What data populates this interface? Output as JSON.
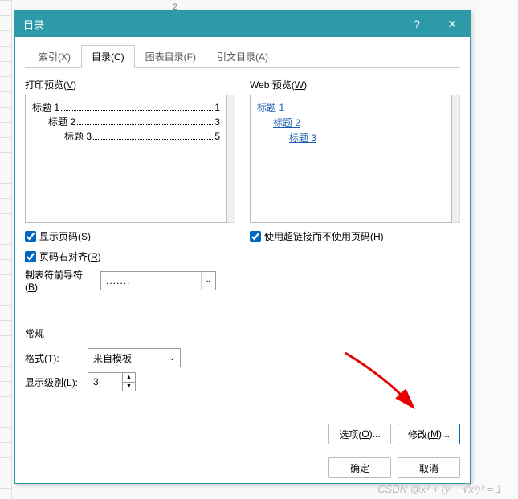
{
  "titlebar": {
    "title": "目录",
    "help": "?",
    "close": "✕"
  },
  "tabs": [
    {
      "label": "索引(X)"
    },
    {
      "label": "目录(C)"
    },
    {
      "label": "图表目录(F)"
    },
    {
      "label": "引文目录(A)"
    }
  ],
  "printPreview": {
    "label_pre": "打印预览(",
    "label_key": "V",
    "label_post": ")",
    "items": [
      {
        "indent": 0,
        "label": "标题 1",
        "page": "1"
      },
      {
        "indent": 1,
        "label": "标题 2",
        "page": "3"
      },
      {
        "indent": 2,
        "label": "标题 3",
        "page": "5"
      }
    ]
  },
  "webPreview": {
    "label_pre": "Web 预览(",
    "label_key": "W",
    "label_post": ")",
    "items": [
      {
        "indent": 0,
        "label": "标题 1"
      },
      {
        "indent": 1,
        "label": "标题 2"
      },
      {
        "indent": 2,
        "label": "标题 3"
      }
    ]
  },
  "options": {
    "showPageNum": {
      "pre": "显示页码(",
      "key": "S",
      "post": ")"
    },
    "rightAlign": {
      "pre": "页码右对齐(",
      "key": "R",
      "post": ")"
    },
    "useHyperlinks": {
      "pre": "使用超链接而不使用页码(",
      "key": "H",
      "post": ")"
    }
  },
  "leader": {
    "label_pre": "制表符前导符(",
    "label_key": "B",
    "label_post": "):",
    "value": "......."
  },
  "general": {
    "title": "常规",
    "format": {
      "label_pre": "格式(",
      "label_key": "T",
      "label_post": "):",
      "value": "来自模板"
    },
    "levels": {
      "label_pre": "显示级别(",
      "label_key": "L",
      "label_post": "):",
      "value": "3"
    }
  },
  "buttons": {
    "options": {
      "pre": "选项(",
      "key": "O",
      "post": ")..."
    },
    "modify": {
      "pre": "修改(",
      "key": "M",
      "post": ")..."
    },
    "ok": "确定",
    "cancel": "取消"
  },
  "ruler_num": "2",
  "watermark": "CSDN @x² + (y − ∛x²)² = 1"
}
